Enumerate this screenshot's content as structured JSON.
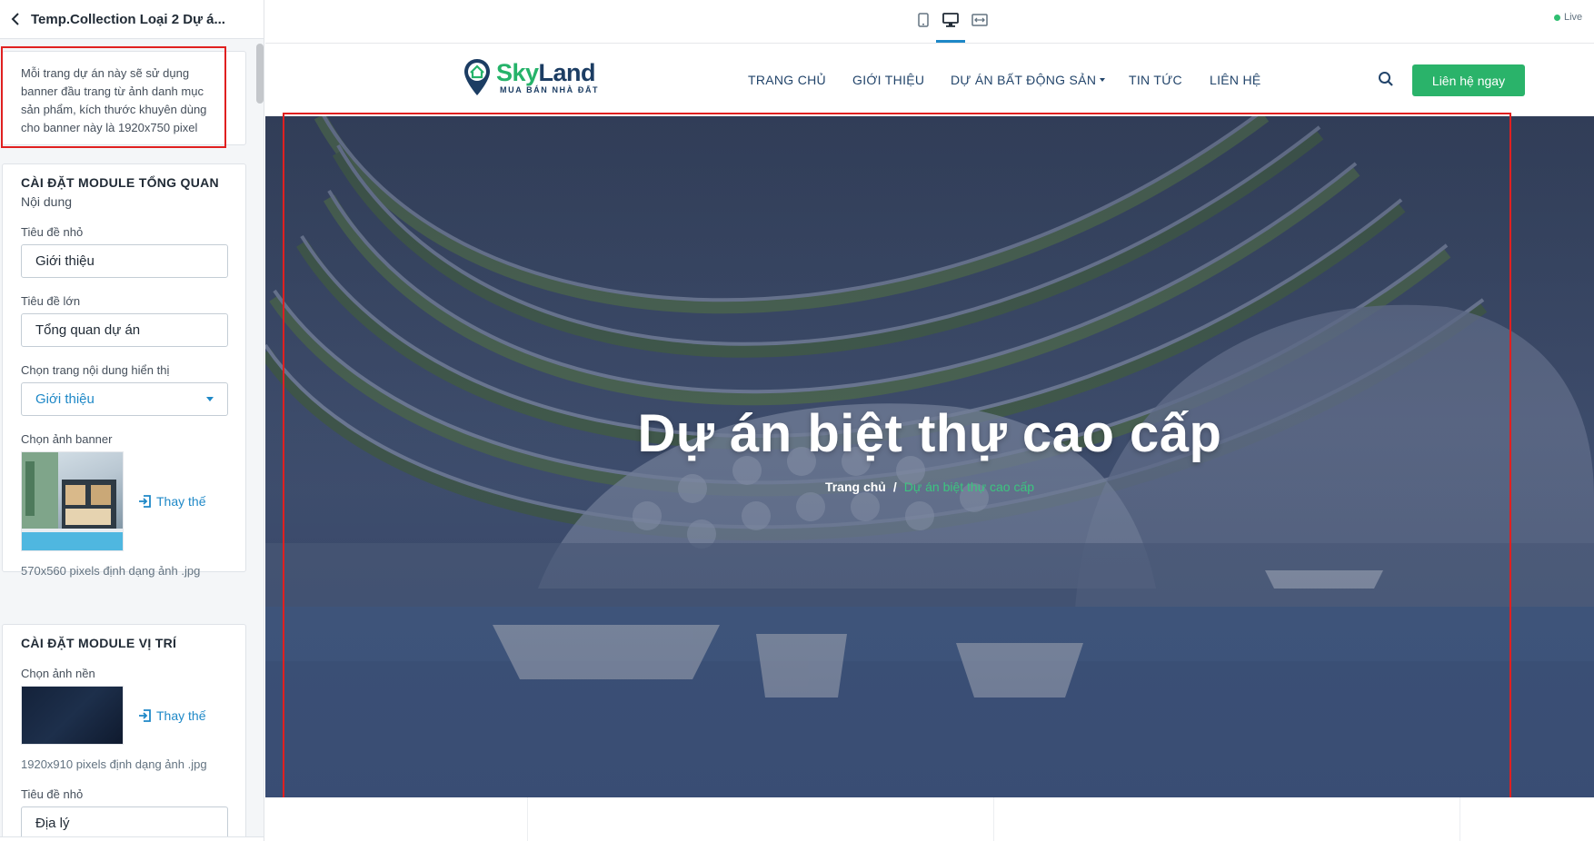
{
  "editor": {
    "title": "Temp.Collection Loại 2 Dự á...",
    "note": "Mỗi trang dự án này sẽ sử dụng banner đầu trang từ ảnh danh mục sản phẩm, kích thước khuyên dùng cho banner này là 1920x750 pixel",
    "overview": {
      "section_title": "CÀI ĐẶT MODULE TỔNG QUAN",
      "section_sub": "Nội dung",
      "small_title_label": "Tiêu đề nhỏ",
      "small_title_value": "Giới thiệu",
      "large_title_label": "Tiêu đề lớn",
      "large_title_value": "Tổng quan dự án",
      "page_select_label": "Chọn trang nội dung hiển thị",
      "page_select_value": "Giới thiệu",
      "banner_label": "Chọn ảnh banner",
      "replace_label": "Thay thế",
      "banner_hint": "570x560 pixels định dạng ảnh .jpg"
    },
    "location": {
      "section_title": "CÀI ĐẶT MODULE VỊ TRÍ",
      "bg_label": "Chọn ảnh nền",
      "replace_label": "Thay thế",
      "bg_hint": "1920x910 pixels định dạng ảnh .jpg",
      "small_title_label": "Tiêu đề nhỏ",
      "small_title_value": "Địa lý"
    }
  },
  "preview_bar": {
    "devices": [
      "mobile-icon",
      "desktop-icon",
      "fullwidth-icon"
    ],
    "selected_device": "desktop",
    "live_label": "Live"
  },
  "site": {
    "logo_sky": "Sky",
    "logo_land": "Land",
    "logo_tagline": "MUA BÁN NHÀ ĐẤT",
    "nav": {
      "home": "TRANG CHỦ",
      "about": "GIỚI THIỆU",
      "projects": "DỰ ÁN BẤT ĐỘNG SẢN",
      "news": "TIN TỨC",
      "contact": "LIÊN HỆ"
    },
    "cta_label": "Liên hệ ngay",
    "hero_title": "Dự án biệt thự cao cấp",
    "breadcrumb_home": "Trang chủ",
    "breadcrumb_sep": "/",
    "breadcrumb_current": "Dự án biệt thự cao cấp"
  },
  "colors": {
    "brand_green": "#2ab36a",
    "brand_navy": "#1c3d63",
    "accent_blue": "#1e88c7",
    "highlight_red": "#e02020"
  }
}
